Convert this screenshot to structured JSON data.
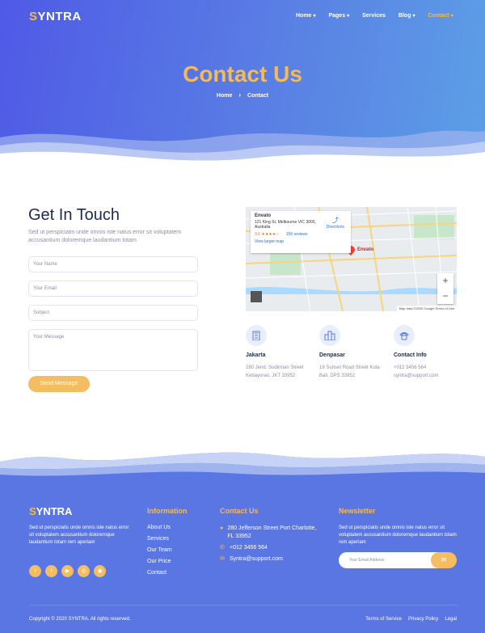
{
  "header": {
    "logo_first": "S",
    "logo_rest": "YNTRA",
    "nav": [
      {
        "label": "Home",
        "caret": "▾"
      },
      {
        "label": "Pages",
        "caret": "▾"
      },
      {
        "label": "Services",
        "caret": ""
      },
      {
        "label": "Blog",
        "caret": "▾"
      },
      {
        "label": "Contact",
        "caret": "▾"
      }
    ]
  },
  "hero": {
    "title": "Contact Us",
    "crumb_home": "Home",
    "crumb_sep": "›",
    "crumb_current": "Contact"
  },
  "contact_form": {
    "title": "Get In Touch",
    "description": "Sed ut perspiciatis unde omnis iste natus error sit voluptatem accusantium doloremque laudantium totam",
    "name_placeholder": "Your Name",
    "email_placeholder": "Your Email",
    "subject_placeholder": "Subject",
    "message_placeholder": "Your Message",
    "submit_label": "Send Message"
  },
  "map": {
    "place": "Envato",
    "address": "121 King St, Melbourne VIC 3000, Australia",
    "rating": "3.6 ★★★★☆",
    "reviews": "156 reviews",
    "larger_map": "View larger map",
    "directions": "Directions",
    "pin_label": "Envato",
    "footer_text": "Map data ©2020 Google   Terms of Use",
    "zoom_in": "+",
    "zoom_out": "−"
  },
  "contact_info": [
    {
      "title": "Jakarta",
      "line1": "280 Jend. Sudirman Street",
      "line2": "Kebayoran, JKT 33952",
      "icon": "building-icon"
    },
    {
      "title": "Denpasar",
      "line1": "19 Sunset Road Street Kuta",
      "line2": "Bali, DPS 33952",
      "icon": "city-icon"
    },
    {
      "title": "Contact Info",
      "line1": "+012 3456 564",
      "line2": "syntra@support.com",
      "icon": "phone-icon"
    }
  ],
  "footer": {
    "logo_first": "S",
    "logo_rest": "YNTRA",
    "description": "Sed ut perspiciatis unde omnis iste natus error sit voluptatem accusantium doloremque laudantium totam rem aperiam",
    "social": [
      "t",
      "f",
      "▶",
      "◎",
      "◉"
    ],
    "info_title": "Information",
    "info_links": [
      "About Us",
      "Services",
      "Our Team",
      "Our Price",
      "Contact"
    ],
    "contact_title": "Contact Us",
    "address": "280 Jefferson Street Port Charlotte, FL 33952",
    "phone": "+012 3456 564",
    "email": "Syntra@support.com",
    "newsletter_title": "Newsletter",
    "newsletter_desc": "Sed ut perspiciatis unde omnis iste natus error sit voluptatem accusantium doloremque laudantium totam rem aperiam",
    "newsletter_placeholder": "Your Email Address",
    "newsletter_button": "✉",
    "copyright": "Copyright © 2020 SYNTRA. All rights reserved.",
    "legal": [
      "Terms of Service",
      "Privacy Policy",
      "Legal"
    ]
  },
  "colors": {
    "accent": "#f5bd62",
    "brand_blue": "#5a76e3",
    "heading": "#1f2a4f"
  }
}
